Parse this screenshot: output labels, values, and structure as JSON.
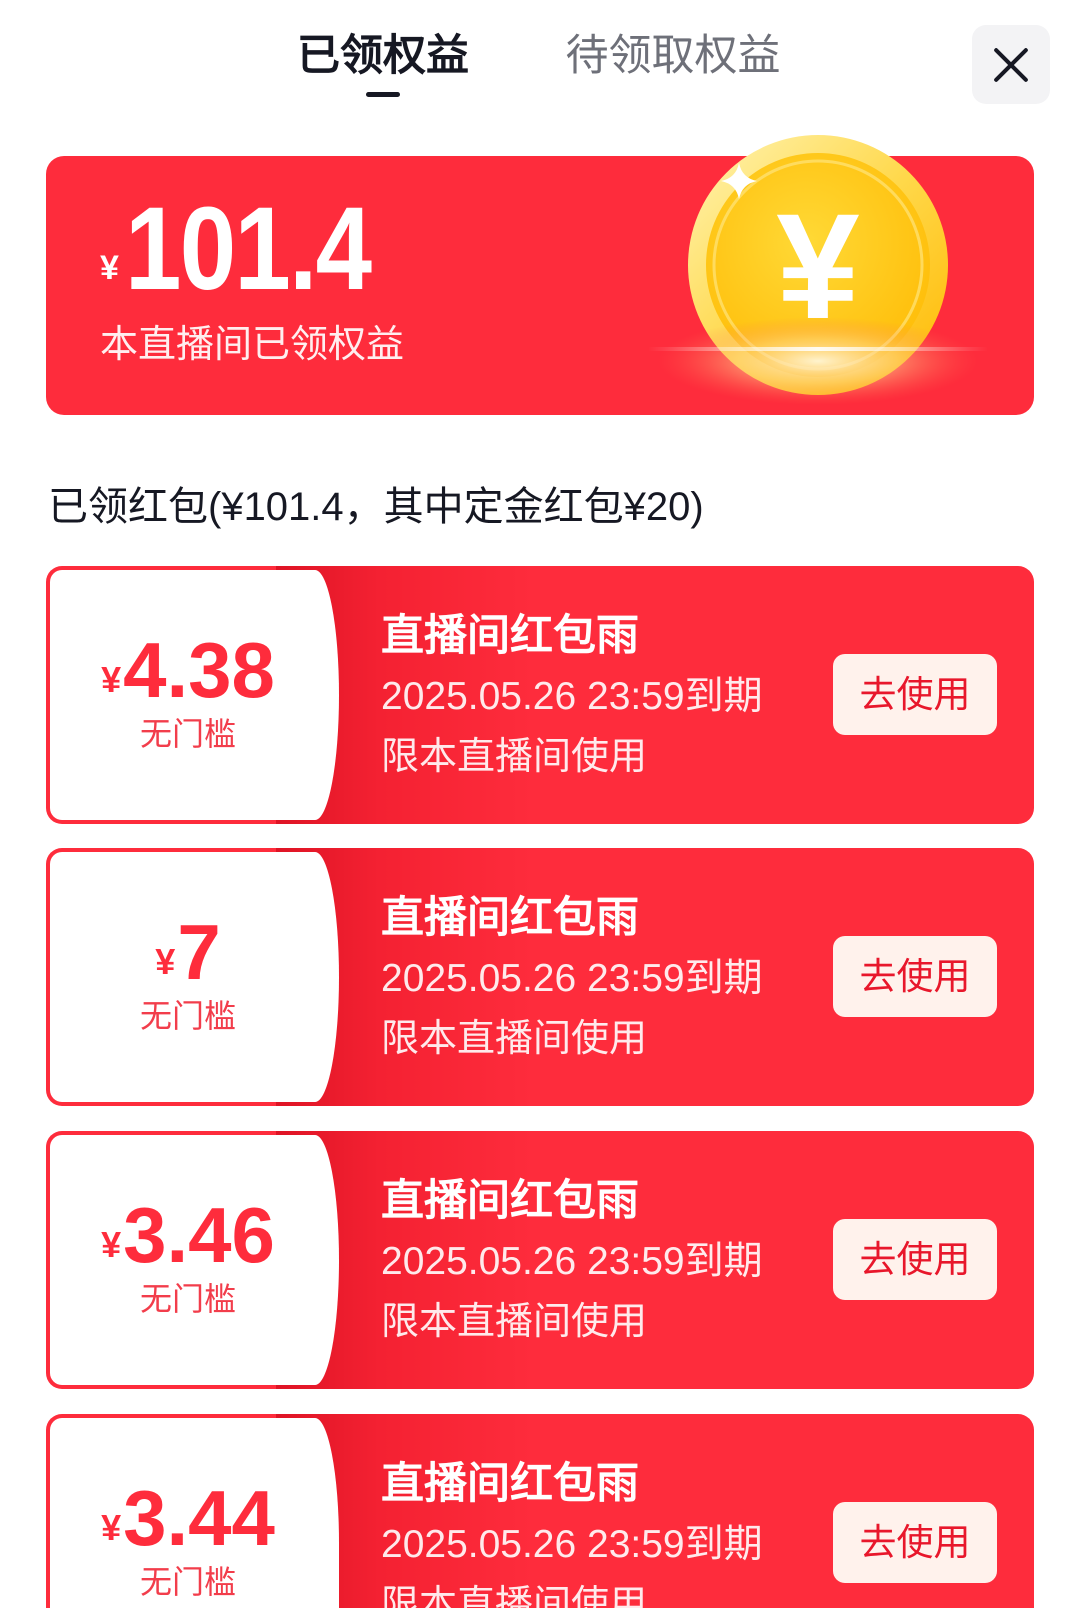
{
  "tabs": [
    {
      "label": "已领权益",
      "active": true
    },
    {
      "label": "待领取权益",
      "active": false
    }
  ],
  "close_button": {
    "icon": "close-icon"
  },
  "summary": {
    "currency": "¥",
    "amount": "101.4",
    "caption": "本直播间已领权益",
    "coin_icon": "yen-coin-icon",
    "coin_symbol": "¥"
  },
  "section_title": "已领红包(¥101.4，其中定金红包¥20)",
  "coupons": [
    {
      "currency": "¥",
      "amount": "4.38",
      "threshold": "无门槛",
      "title": "直播间红包雨",
      "expiry": "2025.05.26 23:59到期",
      "scope": "限本直播间使用",
      "action": "去使用"
    },
    {
      "currency": "¥",
      "amount": "7",
      "threshold": "无门槛",
      "title": "直播间红包雨",
      "expiry": "2025.05.26 23:59到期",
      "scope": "限本直播间使用",
      "action": "去使用"
    },
    {
      "currency": "¥",
      "amount": "3.46",
      "threshold": "无门槛",
      "title": "直播间红包雨",
      "expiry": "2025.05.26 23:59到期",
      "scope": "限本直播间使用",
      "action": "去使用"
    },
    {
      "currency": "¥",
      "amount": "3.44",
      "threshold": "无门槛",
      "title": "直播间红包雨",
      "expiry": "2025.05.26 23:59到期",
      "scope": "限本直播间使用",
      "action": "去使用"
    }
  ],
  "colors": {
    "brand_red": "#FE2C3C",
    "text_primary": "#161823",
    "text_secondary": "#6E7079",
    "button_bg": "#FFF2EC",
    "button_text": "#E8172B",
    "coupon_text": "#F23D4B",
    "close_bg": "#F3F3F5"
  }
}
